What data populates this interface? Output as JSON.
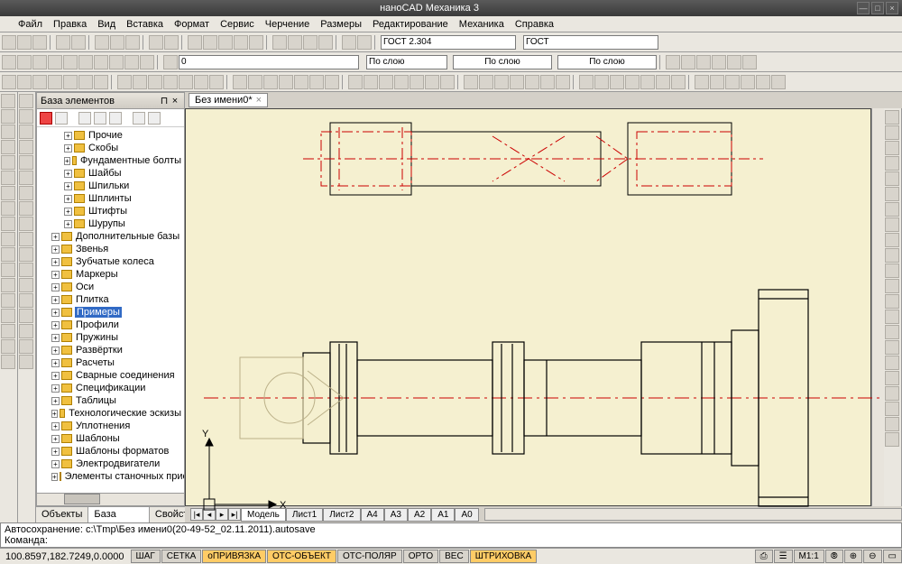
{
  "app": {
    "title": "наноCAD Механика 3"
  },
  "menu": [
    "Файл",
    "Правка",
    "Вид",
    "Вставка",
    "Формат",
    "Сервис",
    "Черчение",
    "Размеры",
    "Редактирование",
    "Механика",
    "Справка"
  ],
  "toolbars": {
    "style1": "ГОСТ 2.304",
    "style2": "ГОСТ",
    "layer_opt": "0",
    "bylayer1": "По слою",
    "bylayer2": "По слою",
    "bylayer3": "По слою"
  },
  "sidepanel": {
    "title": "База элементов",
    "tree": [
      {
        "ind": 2,
        "exp": "+",
        "label": "Прочие"
      },
      {
        "ind": 2,
        "exp": "+",
        "label": "Скобы"
      },
      {
        "ind": 2,
        "exp": "+",
        "label": "Фундаментные болты"
      },
      {
        "ind": 2,
        "exp": "+",
        "label": "Шайбы"
      },
      {
        "ind": 2,
        "exp": "+",
        "label": "Шпильки"
      },
      {
        "ind": 2,
        "exp": "+",
        "label": "Шплинты"
      },
      {
        "ind": 2,
        "exp": "+",
        "label": "Штифты"
      },
      {
        "ind": 2,
        "exp": "+",
        "label": "Шурупы"
      },
      {
        "ind": 1,
        "exp": "+",
        "label": "Дополнительные базы"
      },
      {
        "ind": 1,
        "exp": "+",
        "label": "Звенья"
      },
      {
        "ind": 1,
        "exp": "+",
        "label": "Зубчатые колеса"
      },
      {
        "ind": 1,
        "exp": "+",
        "label": "Маркеры"
      },
      {
        "ind": 1,
        "exp": "+",
        "label": "Оси"
      },
      {
        "ind": 1,
        "exp": "+",
        "label": "Плитка"
      },
      {
        "ind": 1,
        "exp": "+",
        "label": "Примеры",
        "sel": true
      },
      {
        "ind": 1,
        "exp": "+",
        "label": "Профили"
      },
      {
        "ind": 1,
        "exp": "+",
        "label": "Пружины"
      },
      {
        "ind": 1,
        "exp": "+",
        "label": "Развёртки"
      },
      {
        "ind": 1,
        "exp": "+",
        "label": "Расчеты"
      },
      {
        "ind": 1,
        "exp": "+",
        "label": "Сварные соединения"
      },
      {
        "ind": 1,
        "exp": "+",
        "label": "Спецификации"
      },
      {
        "ind": 1,
        "exp": "+",
        "label": "Таблицы"
      },
      {
        "ind": 1,
        "exp": "+",
        "label": "Технологические эскизы"
      },
      {
        "ind": 1,
        "exp": "+",
        "label": "Уплотнения"
      },
      {
        "ind": 1,
        "exp": "+",
        "label": "Шаблоны"
      },
      {
        "ind": 1,
        "exp": "+",
        "label": "Шаблоны форматов"
      },
      {
        "ind": 1,
        "exp": "+",
        "label": "Электродвигатели"
      },
      {
        "ind": 1,
        "exp": "+",
        "label": "Элементы станочных приспо"
      }
    ],
    "tabs": [
      "Объекты",
      "База элементов",
      "Свойства"
    ],
    "active_tab": 1
  },
  "doc": {
    "tab": "Без имени0*"
  },
  "layout_tabs": [
    "Модель",
    "Лист1",
    "Лист2",
    "A4",
    "A3",
    "A2",
    "A1",
    "A0"
  ],
  "cmd": {
    "line1": "Автосохранение: c:\\Tmp\\Без имени0(20-49-52_02.11.2011).autosave",
    "line2": "Команда:"
  },
  "status": {
    "coord": "100.8597,182.7249,0.0000",
    "ucs_x": "X",
    "ucs_y": "Y",
    "buttons": [
      {
        "label": "ШАГ",
        "on": false
      },
      {
        "label": "СЕТКА",
        "on": false
      },
      {
        "label": "оПРИВЯЗКА",
        "on": true
      },
      {
        "label": "ОТС-ОБЪЕКТ",
        "on": true
      },
      {
        "label": "ОТС-ПОЛЯР",
        "on": false
      },
      {
        "label": "ОРТО",
        "on": false
      },
      {
        "label": "ВЕС",
        "on": false
      },
      {
        "label": "ШТРИХОВКА",
        "on": true
      }
    ],
    "scale": "М1:1"
  }
}
